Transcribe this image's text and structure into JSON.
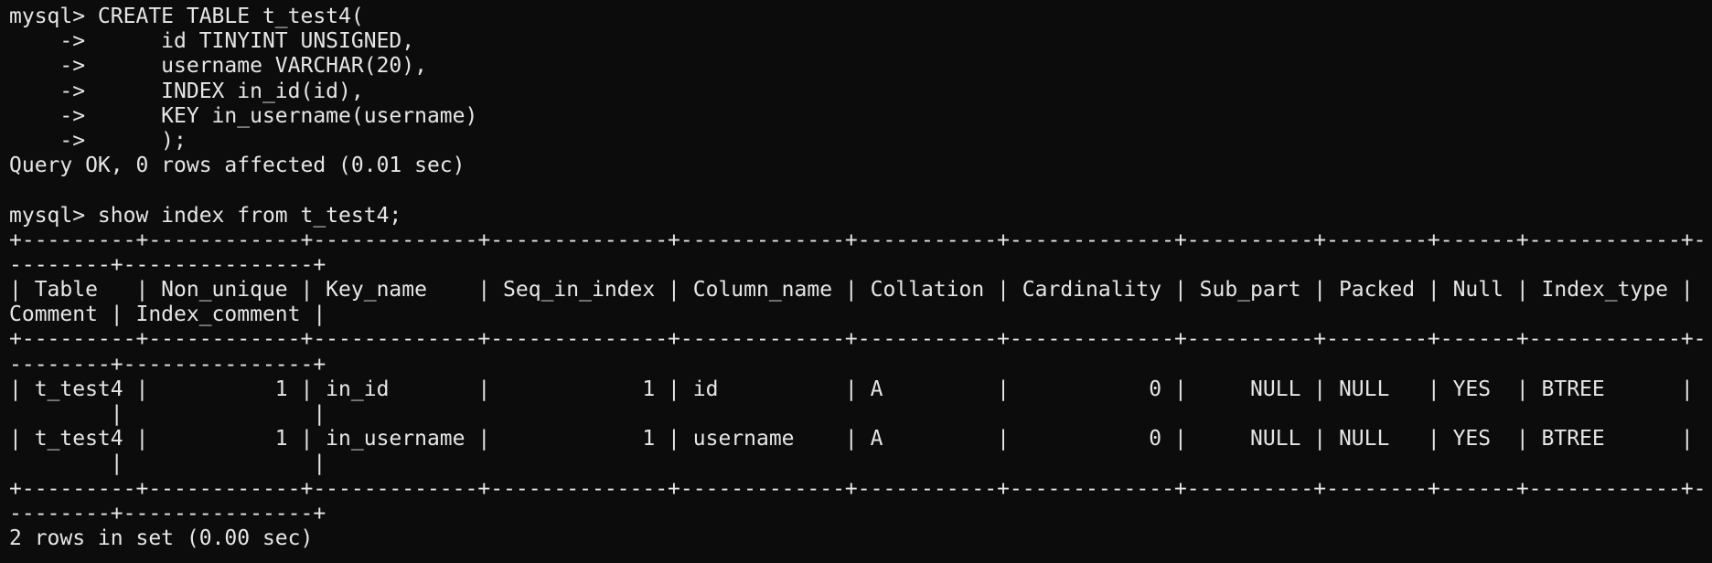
{
  "terminal": {
    "lines": [
      "mysql> CREATE TABLE t_test4(",
      "    ->      id TINYINT UNSIGNED,",
      "    ->      username VARCHAR(20),",
      "    ->      INDEX in_id(id),",
      "    ->      KEY in_username(username)",
      "    ->      );",
      "Query OK, 0 rows affected (0.01 sec)",
      "",
      "mysql> show index from t_test4;",
      "+---------+------------+-------------+--------------+-------------+-----------+-------------+----------+--------+------+------------+-",
      "--------+---------------+",
      "| Table   | Non_unique | Key_name    | Seq_in_index | Column_name | Collation | Cardinality | Sub_part | Packed | Null | Index_type |",
      "Comment | Index_comment |",
      "+---------+------------+-------------+--------------+-------------+-----------+-------------+----------+--------+------+------------+-",
      "--------+---------------+",
      "| t_test4 |          1 | in_id       |            1 | id          | A         |           0 |     NULL | NULL   | YES  | BTREE      |",
      "        |               |",
      "| t_test4 |          1 | in_username |            1 | username    | A         |           0 |     NULL | NULL   | YES  | BTREE      |",
      "        |               |",
      "+---------+------------+-------------+--------------+-------------+-----------+-------------+----------+--------+------+------------+-",
      "--------+---------------+",
      "2 rows in set (0.00 sec)"
    ]
  }
}
